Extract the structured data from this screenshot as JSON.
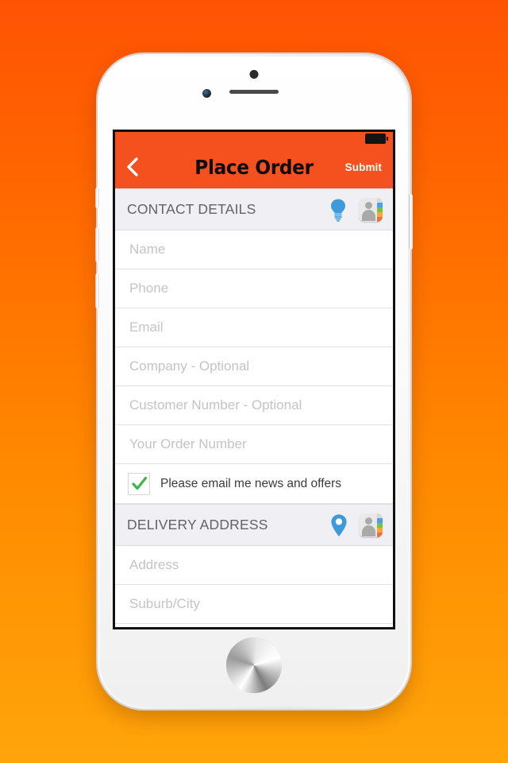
{
  "status_bar": {
    "battery_icon": "battery-full-icon"
  },
  "nav": {
    "back_icon": "chevron-left-icon",
    "title": "Place Order",
    "submit_label": "Submit"
  },
  "sections": [
    {
      "id": "contact-details",
      "title": "CONTACT DETAILS",
      "icons": [
        "lightbulb-icon",
        "contacts-icon"
      ],
      "fields": [
        {
          "name": "name",
          "placeholder": "Name",
          "value": ""
        },
        {
          "name": "phone",
          "placeholder": "Phone",
          "value": ""
        },
        {
          "name": "email",
          "placeholder": "Email",
          "value": ""
        },
        {
          "name": "company",
          "placeholder": "Company - Optional",
          "value": ""
        },
        {
          "name": "customer-number",
          "placeholder": "Customer Number - Optional",
          "value": ""
        },
        {
          "name": "order-number",
          "placeholder": "Your Order Number",
          "value": ""
        }
      ],
      "checkbox": {
        "label": "Please email me news and offers",
        "checked": true,
        "check_glyph": "✓"
      }
    },
    {
      "id": "delivery-address",
      "title": "DELIVERY ADDRESS",
      "icons": [
        "map-pin-icon",
        "contacts-icon"
      ],
      "fields": [
        {
          "name": "address",
          "placeholder": "Address",
          "value": ""
        },
        {
          "name": "suburb-city",
          "placeholder": "Suburb/City",
          "value": ""
        }
      ]
    }
  ],
  "colors": {
    "brand_orange": "#F4511E",
    "background_top": "#FF5304",
    "background_bottom": "#FFA50A",
    "section_header_bg": "#EFEFF4",
    "accent_blue": "#3E9BD9",
    "check_green": "#3CB54A",
    "placeholder_gray": "#C4C4C7"
  }
}
